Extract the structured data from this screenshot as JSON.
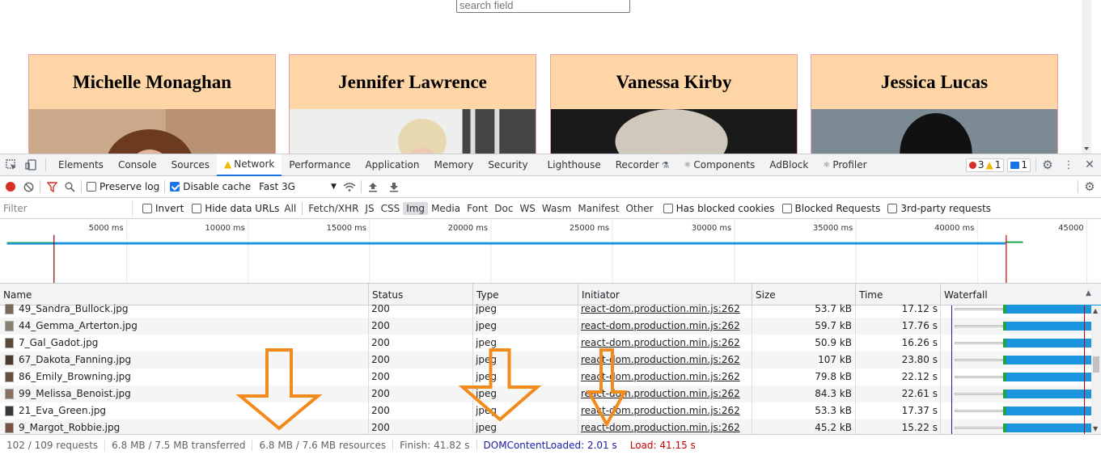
{
  "page": {
    "search_placeholder": "search field",
    "cards": [
      {
        "name": "Michelle Monaghan"
      },
      {
        "name": "Jennifer Lawrence"
      },
      {
        "name": "Vanessa Kirby"
      },
      {
        "name": "Jessica Lucas"
      }
    ]
  },
  "devtools": {
    "tabs": [
      "Elements",
      "Console",
      "Sources",
      "Network",
      "Performance",
      "Application",
      "Memory",
      "Security",
      "Lighthouse",
      "Recorder",
      "Components",
      "AdBlock",
      "Profiler"
    ],
    "active_tab": "Network",
    "badges": {
      "errors": "3",
      "warnings": "1",
      "messages": "1"
    },
    "toolbar": {
      "preserve_log": "Preserve log",
      "disable_cache": "Disable cache",
      "throttle": "Fast 3G"
    },
    "filter": {
      "placeholder": "Filter",
      "invert": "Invert",
      "hide_data_urls": "Hide data URLs",
      "types": [
        "All",
        "Fetch/XHR",
        "JS",
        "CSS",
        "Img",
        "Media",
        "Font",
        "Doc",
        "WS",
        "Wasm",
        "Manifest",
        "Other"
      ],
      "selected_type": "Img",
      "has_blocked_cookies": "Has blocked cookies",
      "blocked_requests": "Blocked Requests",
      "third_party": "3rd-party requests"
    },
    "overview_ticks": [
      "5000 ms",
      "10000 ms",
      "15000 ms",
      "20000 ms",
      "25000 ms",
      "30000 ms",
      "35000 ms",
      "40000 ms",
      "45000"
    ],
    "columns": [
      "Name",
      "Status",
      "Type",
      "Initiator",
      "Size",
      "Time",
      "Waterfall"
    ],
    "rows": [
      {
        "name": "49_Sandra_Bullock.jpg",
        "status": "200",
        "type": "jpeg",
        "initiator": "react-dom.production.min.js:262",
        "size": "53.7 kB",
        "time": "17.12 s",
        "wf_end": 0.71
      },
      {
        "name": "44_Gemma_Arterton.jpg",
        "status": "200",
        "type": "jpeg",
        "initiator": "react-dom.production.min.js:262",
        "size": "59.7 kB",
        "time": "17.76 s",
        "wf_end": 0.72
      },
      {
        "name": "7_Gal_Gadot.jpg",
        "status": "200",
        "type": "jpeg",
        "initiator": "react-dom.production.min.js:262",
        "size": "50.9 kB",
        "time": "16.26 s",
        "wf_end": 0.69
      },
      {
        "name": "67_Dakota_Fanning.jpg",
        "status": "200",
        "type": "jpeg",
        "initiator": "react-dom.production.min.js:262",
        "size": "107 kB",
        "time": "23.80 s",
        "wf_end": 0.84
      },
      {
        "name": "86_Emily_Browning.jpg",
        "status": "200",
        "type": "jpeg",
        "initiator": "react-dom.production.min.js:262",
        "size": "79.8 kB",
        "time": "22.12 s",
        "wf_end": 0.81
      },
      {
        "name": "99_Melissa_Benoist.jpg",
        "status": "200",
        "type": "jpeg",
        "initiator": "react-dom.production.min.js:262",
        "size": "84.3 kB",
        "time": "22.61 s",
        "wf_end": 0.82
      },
      {
        "name": "21_Eva_Green.jpg",
        "status": "200",
        "type": "jpeg",
        "initiator": "react-dom.production.min.js:262",
        "size": "53.3 kB",
        "time": "17.37 s",
        "wf_end": 0.71
      },
      {
        "name": "9_Margot_Robbie.jpg",
        "status": "200",
        "type": "jpeg",
        "initiator": "react-dom.production.min.js:262",
        "size": "45.2 kB",
        "time": "15.22 s",
        "wf_end": 0.67
      }
    ],
    "status": {
      "requests": "102 / 109 requests",
      "transferred": "6.8 MB / 7.5 MB transferred",
      "resources": "6.8 MB / 7.6 MB resources",
      "finish": "Finish: 41.82 s",
      "dcl": "DOMContentLoaded: 2.01 s",
      "load": "Load: 41.15 s"
    },
    "annotation_color": "#f28a1c"
  }
}
